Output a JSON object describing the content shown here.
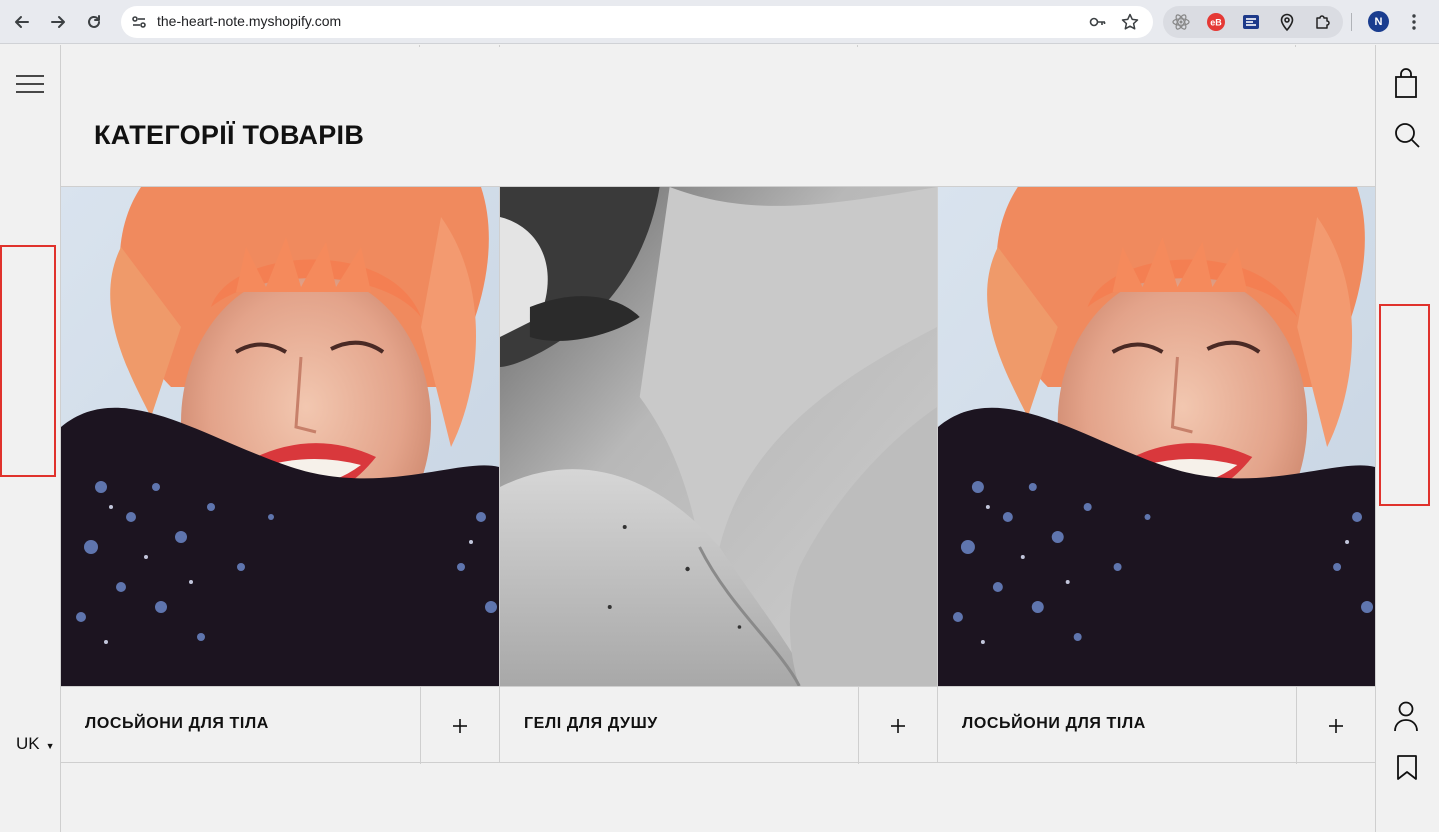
{
  "browser": {
    "url": "the-heart-note.myshopify.com",
    "profile_initial": "N",
    "icons": [
      "back-icon",
      "forward-icon",
      "reload-icon",
      "site-settings-icon",
      "password-key-icon",
      "bookmark-star-icon",
      "react-devtools-icon",
      "extension-red-icon",
      "extension-stack-icon",
      "location-pin-icon",
      "extensions-puzzle-icon",
      "more-menu-icon"
    ]
  },
  "left_rail": {
    "menu_icon": "hamburger-icon",
    "language": "UK"
  },
  "right_rail": {
    "icons": [
      "shopping-bag-icon",
      "search-icon",
      "account-icon",
      "wishlist-bookmark-icon"
    ]
  },
  "section": {
    "title": "КАТЕГОРІЇ ТОВАРІВ"
  },
  "categories": [
    {
      "label": "ЛОСЬЙОНИ ДЛЯ ТІЛА",
      "action": "+",
      "image": "smiling woman with pink hair"
    },
    {
      "label": "ГЕЛІ ДЛЯ ДУШУ",
      "action": "+",
      "image": "black and white close-up of neck"
    },
    {
      "label": "ЛОСЬЙОНИ ДЛЯ ТІЛА",
      "action": "+",
      "image": "smiling woman with pink hair"
    }
  ],
  "colors": {
    "page_background": "#f1f1f1",
    "divider": "#cfcfcf",
    "highlight_box": "#e0322c",
    "text": "#111111"
  }
}
